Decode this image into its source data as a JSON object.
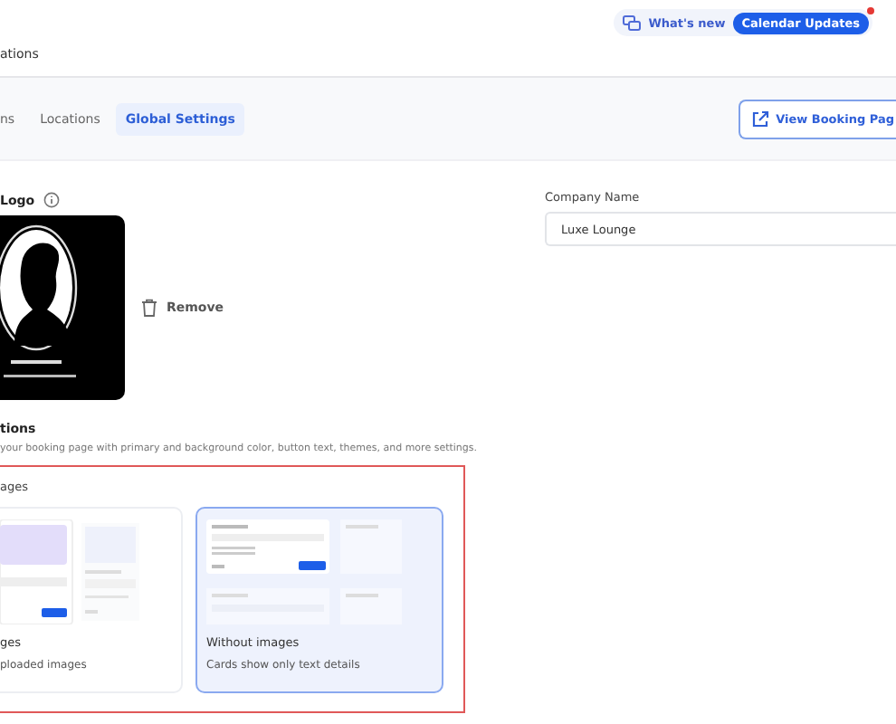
{
  "header": {
    "whats_new": "What's new",
    "update_badge": "Calendar Updates",
    "notification": true,
    "breadcrumb": "ations"
  },
  "tabs": [
    {
      "label": "ns",
      "selected": false
    },
    {
      "label": "Locations",
      "selected": false
    },
    {
      "label": "Global Settings",
      "selected": true
    }
  ],
  "view_button": "View Booking Pag",
  "logo": {
    "label": "Logo",
    "remove": "Remove"
  },
  "company": {
    "label": "Company Name",
    "value": "Luxe Lounge"
  },
  "design": {
    "title": "tions",
    "description": "your booking page with primary and background color, button text, themes, and more settings."
  },
  "images_section": {
    "title": "ages",
    "options": [
      {
        "kind": "images",
        "title": "ges",
        "description": "ploaded images",
        "selected": false
      },
      {
        "kind": "text",
        "title": "Without images",
        "description": "Cards show only text details",
        "selected": true
      }
    ]
  }
}
